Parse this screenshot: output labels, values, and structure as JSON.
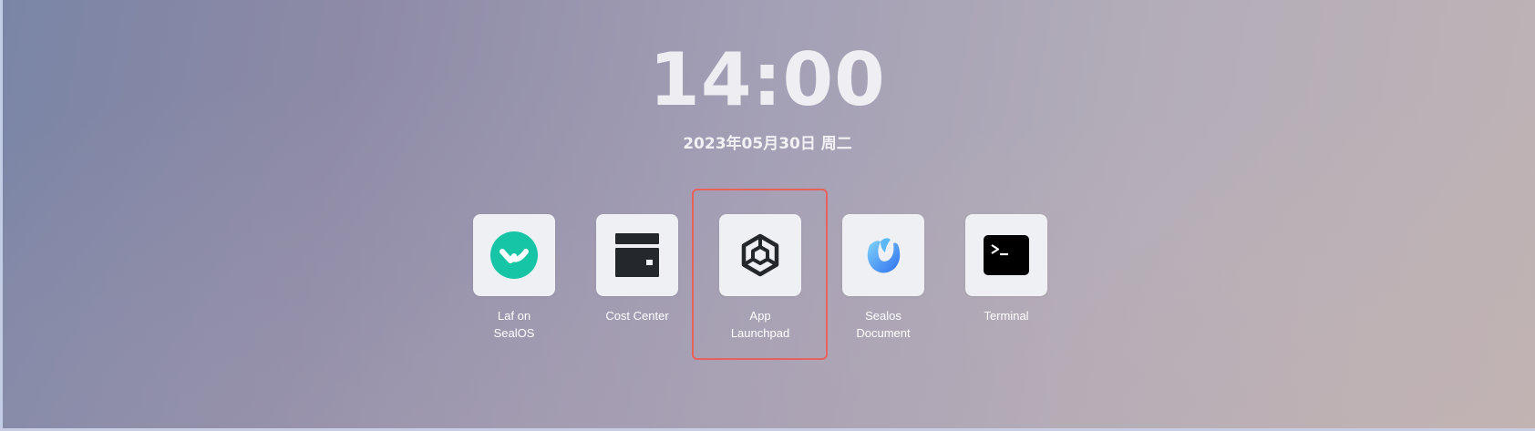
{
  "clock": {
    "time": "14:00",
    "date": "2023年05月30日 周二"
  },
  "apps": [
    {
      "label": "Laf on\nSealOS",
      "icon": "laf-logo-icon",
      "color": "#16c5a5"
    },
    {
      "label": "Cost Center",
      "icon": "wallet-icon",
      "color": "#24272b"
    },
    {
      "label": "App\nLaunchpad",
      "icon": "hexagon-launchpad-icon",
      "color": "#24272b"
    },
    {
      "label": "Sealos\nDocument",
      "icon": "sealos-document-icon",
      "color": "#3d8cf5"
    },
    {
      "label": "Terminal",
      "icon": "terminal-icon",
      "color": "#000000"
    }
  ],
  "highlight_color": "#e8625d"
}
